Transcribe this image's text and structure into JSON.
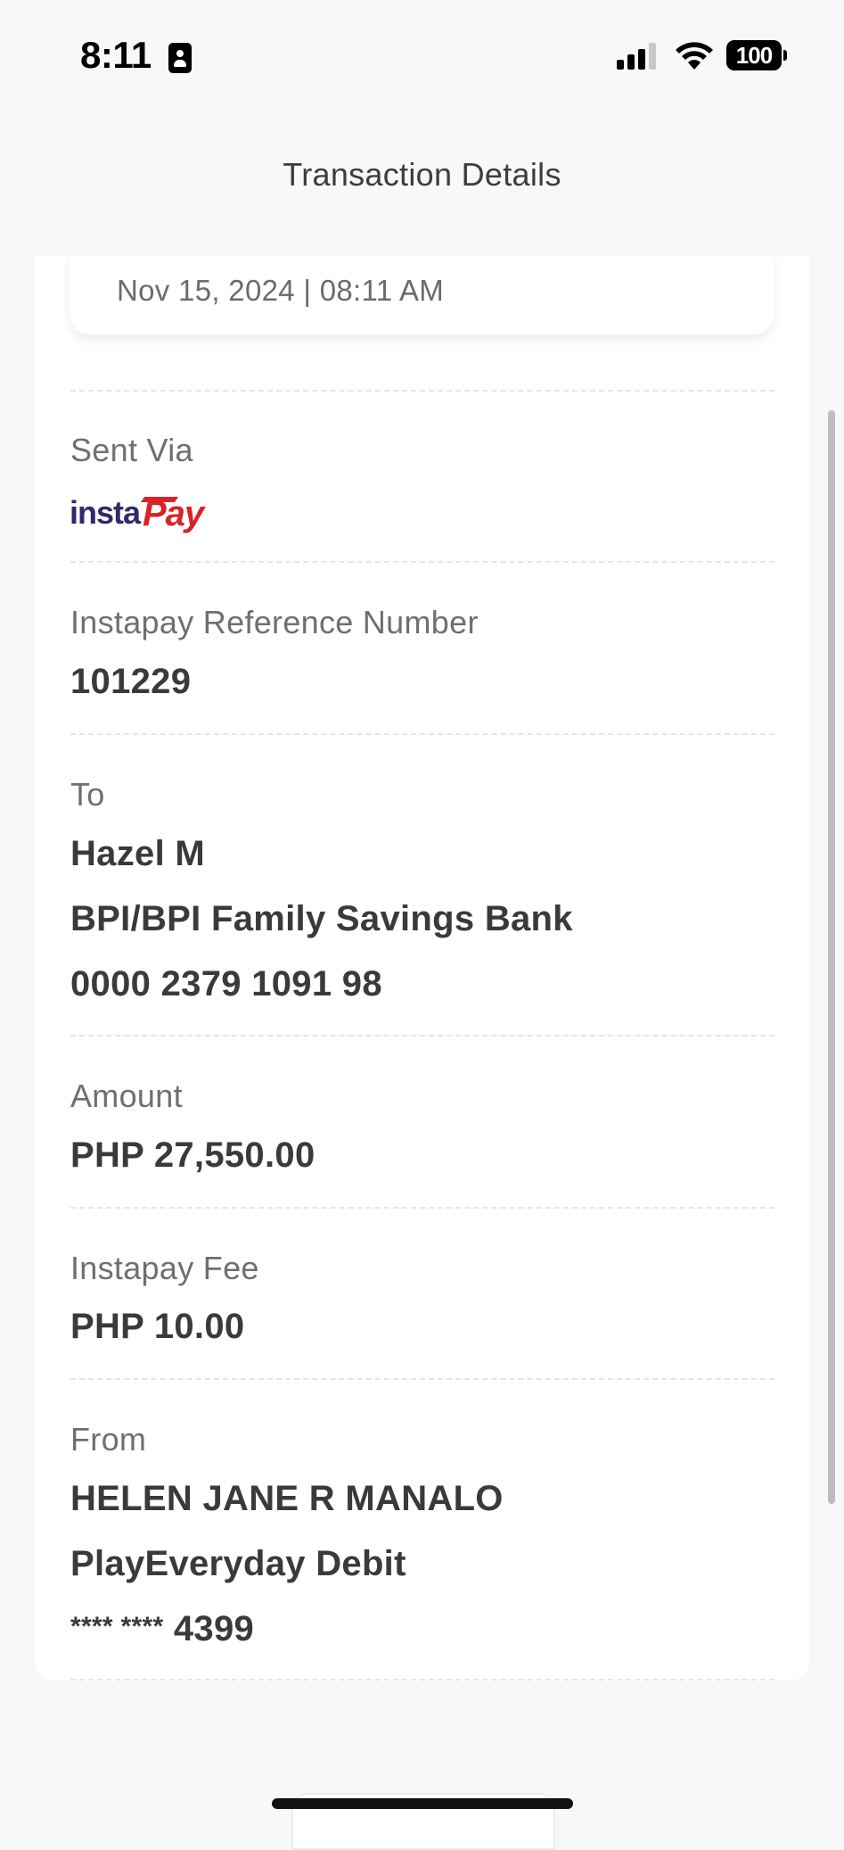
{
  "status_bar": {
    "time": "8:11",
    "battery": "100"
  },
  "header": {
    "title": "Transaction Details"
  },
  "summary": {
    "date": "Nov 15, 2024 | 08:11 AM"
  },
  "sent_via": {
    "label": "Sent Via",
    "logo_text_insta": "insta",
    "logo_text_pay": "Pay"
  },
  "reference": {
    "label": "Instapay Reference Number",
    "value": "101229"
  },
  "recipient": {
    "label": "To",
    "name": "Hazel M",
    "bank": "BPI/BPI Family Savings Bank",
    "account": "0000 2379 1091 98"
  },
  "amount": {
    "label": "Amount",
    "value": "PHP 27,550.00"
  },
  "fee": {
    "label": "Instapay Fee",
    "value": "PHP 10.00"
  },
  "sender": {
    "label": "From",
    "name": "HELEN JANE R MANALO",
    "account_type": "PlayEveryday Debit",
    "account_mask": "**** ****",
    "account_last4": "4399"
  },
  "colors": {
    "instapay_navy": "#2e2a6b",
    "instapay_red": "#d9222a"
  }
}
